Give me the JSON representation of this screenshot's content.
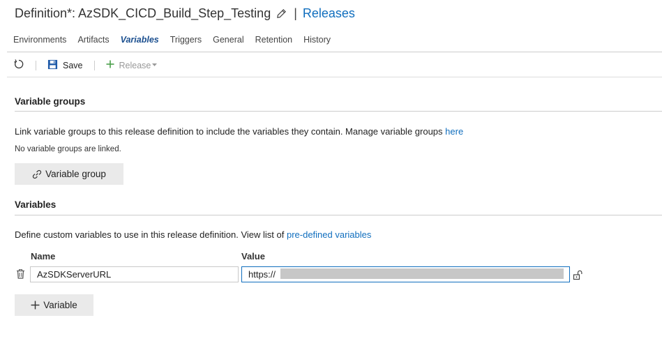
{
  "header": {
    "title": "Definition*: AzSDK_CICD_Build_Step_Testing",
    "separator": "|",
    "releases_link": "Releases"
  },
  "tabs": [
    {
      "label": "Environments"
    },
    {
      "label": "Artifacts"
    },
    {
      "label": "Variables"
    },
    {
      "label": "Triggers"
    },
    {
      "label": "General"
    },
    {
      "label": "Retention"
    },
    {
      "label": "History"
    }
  ],
  "active_tab": "Variables",
  "toolbar": {
    "save_label": "Save",
    "release_label": "Release"
  },
  "variable_groups": {
    "title": "Variable groups",
    "description": "Link variable groups to this release definition to include the variables they contain. Manage variable groups",
    "description_link": "here",
    "empty_text": "No variable groups are linked.",
    "add_button": "Variable group"
  },
  "variables": {
    "title": "Variables",
    "description": "Define custom variables to use in this release definition. View list of",
    "description_link": "pre-defined variables",
    "columns": {
      "name": "Name",
      "value": "Value"
    },
    "rows": [
      {
        "name": "AzSDKServerURL",
        "value": "https://"
      }
    ],
    "add_button": "Variable"
  },
  "colors": {
    "link": "#106ebe",
    "active_tab": "#1b4f8f",
    "save_icon": "#1e5aa8",
    "add_icon": "#4a9e4a",
    "button_bg": "#eaeaea",
    "focus_border": "#106ebe"
  },
  "icons": {
    "edit": "pencil-icon",
    "refresh": "refresh-icon",
    "save": "save-icon",
    "add": "plus-icon",
    "dropdown": "caret-down-icon",
    "link": "link-icon",
    "delete": "trash-icon",
    "secret": "lock-icon"
  }
}
